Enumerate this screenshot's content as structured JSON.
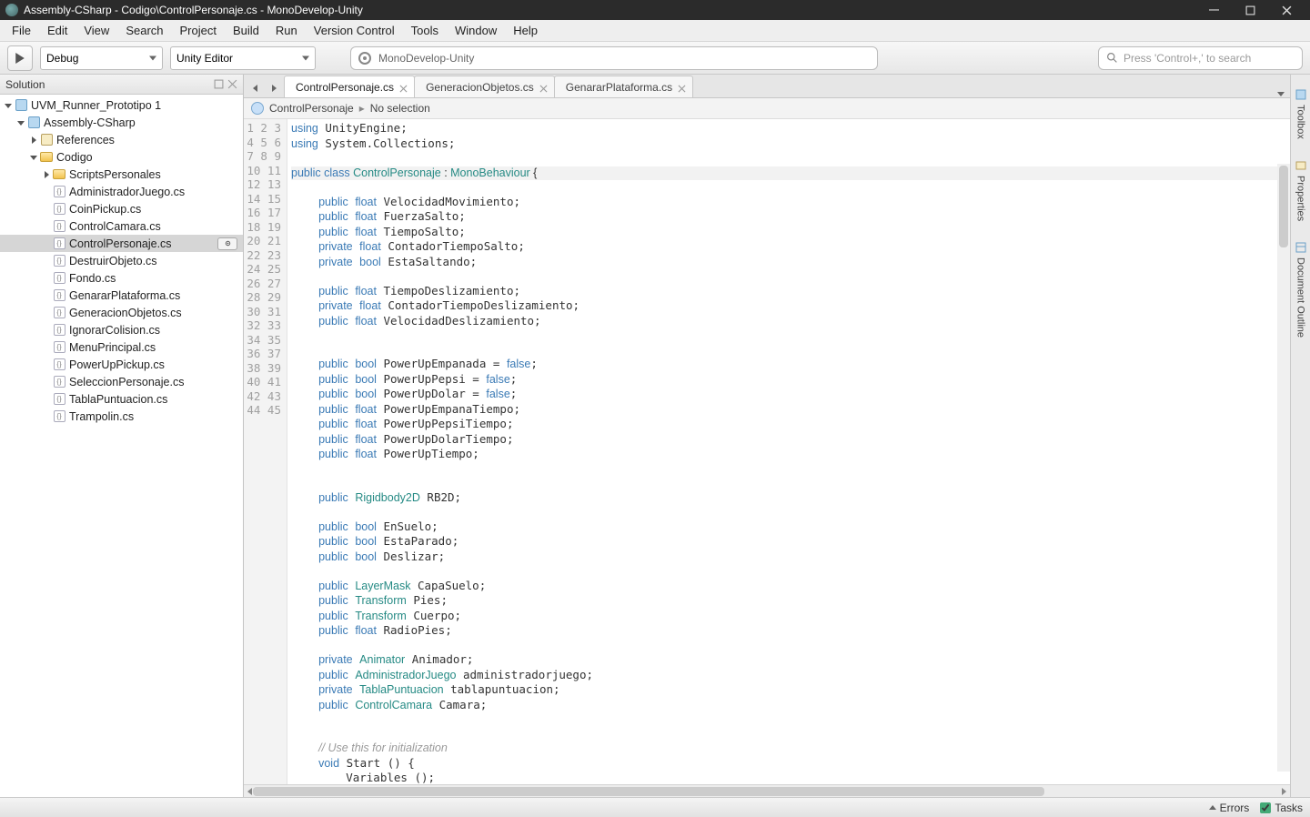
{
  "window_title": "Assembly-CSharp - Codigo\\ControlPersonaje.cs - MonoDevelop-Unity",
  "menubar": [
    "File",
    "Edit",
    "View",
    "Search",
    "Project",
    "Build",
    "Run",
    "Version Control",
    "Tools",
    "Window",
    "Help"
  ],
  "toolbar": {
    "config_selected": "Debug",
    "target_selected": "Unity Editor",
    "mid_search_label": "MonoDevelop-Unity",
    "right_search_placeholder": "Press 'Control+,' to search"
  },
  "solution": {
    "panel_title": "Solution",
    "root": "UVM_Runner_Prototipo 1",
    "assembly": "Assembly-CSharp",
    "references": "References",
    "codigo": "Codigo",
    "scripts": "ScriptsPersonales",
    "files": [
      "AdministradorJuego.cs",
      "CoinPickup.cs",
      "ControlCamara.cs",
      "ControlPersonaje.cs",
      "DestruirObjeto.cs",
      "Fondo.cs",
      "GenararPlataforma.cs",
      "GeneracionObjetos.cs",
      "IgnorarColision.cs",
      "MenuPrincipal.cs",
      "PowerUpPickup.cs",
      "SeleccionPersonaje.cs",
      "TablaPuntuacion.cs",
      "Trampolin.cs"
    ],
    "selected_file_index": 3
  },
  "tabs": [
    {
      "label": "ControlPersonaje.cs",
      "active": true
    },
    {
      "label": "GeneracionObjetos.cs",
      "active": false
    },
    {
      "label": "GenararPlataforma.cs",
      "active": false
    }
  ],
  "breadcrumb": {
    "class": "ControlPersonaje",
    "member": "No selection"
  },
  "code": {
    "first_line": 1,
    "highlight_line": 4,
    "lines": [
      [
        [
          "kw",
          "using"
        ],
        [
          "",
          " UnityEngine;"
        ]
      ],
      [
        [
          "kw",
          "using"
        ],
        [
          "",
          " System.Collections;"
        ]
      ],
      [
        [
          "",
          ""
        ]
      ],
      [
        [
          "kw",
          "public"
        ],
        [
          "",
          " "
        ],
        [
          "kw",
          "class"
        ],
        [
          "",
          " "
        ],
        [
          "type",
          "ControlPersonaje"
        ],
        [
          "",
          " : "
        ],
        [
          "type",
          "MonoBehaviour"
        ],
        [
          "",
          " {"
        ]
      ],
      [
        [
          "",
          ""
        ]
      ],
      [
        [
          "",
          "    "
        ],
        [
          "kw",
          "public"
        ],
        [
          "",
          " "
        ],
        [
          "kw",
          "float"
        ],
        [
          "",
          " VelocidadMovimiento;"
        ]
      ],
      [
        [
          "",
          "    "
        ],
        [
          "kw",
          "public"
        ],
        [
          "",
          " "
        ],
        [
          "kw",
          "float"
        ],
        [
          "",
          " FuerzaSalto;"
        ]
      ],
      [
        [
          "",
          "    "
        ],
        [
          "kw",
          "public"
        ],
        [
          "",
          " "
        ],
        [
          "kw",
          "float"
        ],
        [
          "",
          " TiempoSalto;"
        ]
      ],
      [
        [
          "",
          "    "
        ],
        [
          "kw",
          "private"
        ],
        [
          "",
          " "
        ],
        [
          "kw",
          "float"
        ],
        [
          "",
          " ContadorTiempoSalto;"
        ]
      ],
      [
        [
          "",
          "    "
        ],
        [
          "kw",
          "private"
        ],
        [
          "",
          " "
        ],
        [
          "kw",
          "bool"
        ],
        [
          "",
          " EstaSaltando;"
        ]
      ],
      [
        [
          "",
          ""
        ]
      ],
      [
        [
          "",
          "    "
        ],
        [
          "kw",
          "public"
        ],
        [
          "",
          " "
        ],
        [
          "kw",
          "float"
        ],
        [
          "",
          " TiempoDeslizamiento;"
        ]
      ],
      [
        [
          "",
          "    "
        ],
        [
          "kw",
          "private"
        ],
        [
          "",
          " "
        ],
        [
          "kw",
          "float"
        ],
        [
          "",
          " ContadorTiempoDeslizamiento;"
        ]
      ],
      [
        [
          "",
          "    "
        ],
        [
          "kw",
          "public"
        ],
        [
          "",
          " "
        ],
        [
          "kw",
          "float"
        ],
        [
          "",
          " VelocidadDeslizamiento;"
        ]
      ],
      [
        [
          "",
          ""
        ]
      ],
      [
        [
          "",
          ""
        ]
      ],
      [
        [
          "",
          "    "
        ],
        [
          "kw",
          "public"
        ],
        [
          "",
          " "
        ],
        [
          "kw",
          "bool"
        ],
        [
          "",
          " PowerUpEmpanada = "
        ],
        [
          "lit",
          "false"
        ],
        [
          "",
          ";"
        ]
      ],
      [
        [
          "",
          "    "
        ],
        [
          "kw",
          "public"
        ],
        [
          "",
          " "
        ],
        [
          "kw",
          "bool"
        ],
        [
          "",
          " PowerUpPepsi = "
        ],
        [
          "lit",
          "false"
        ],
        [
          "",
          ";"
        ]
      ],
      [
        [
          "",
          "    "
        ],
        [
          "kw",
          "public"
        ],
        [
          "",
          " "
        ],
        [
          "kw",
          "bool"
        ],
        [
          "",
          " PowerUpDolar = "
        ],
        [
          "lit",
          "false"
        ],
        [
          "",
          ";"
        ]
      ],
      [
        [
          "",
          "    "
        ],
        [
          "kw",
          "public"
        ],
        [
          "",
          " "
        ],
        [
          "kw",
          "float"
        ],
        [
          "",
          " PowerUpEmpanaTiempo;"
        ]
      ],
      [
        [
          "",
          "    "
        ],
        [
          "kw",
          "public"
        ],
        [
          "",
          " "
        ],
        [
          "kw",
          "float"
        ],
        [
          "",
          " PowerUpPepsiTiempo;"
        ]
      ],
      [
        [
          "",
          "    "
        ],
        [
          "kw",
          "public"
        ],
        [
          "",
          " "
        ],
        [
          "kw",
          "float"
        ],
        [
          "",
          " PowerUpDolarTiempo;"
        ]
      ],
      [
        [
          "",
          "    "
        ],
        [
          "kw",
          "public"
        ],
        [
          "",
          " "
        ],
        [
          "kw",
          "float"
        ],
        [
          "",
          " PowerUpTiempo;"
        ]
      ],
      [
        [
          "",
          ""
        ]
      ],
      [
        [
          "",
          ""
        ]
      ],
      [
        [
          "",
          "    "
        ],
        [
          "kw",
          "public"
        ],
        [
          "",
          " "
        ],
        [
          "type",
          "Rigidbody2D"
        ],
        [
          "",
          " RB2D;"
        ]
      ],
      [
        [
          "",
          ""
        ]
      ],
      [
        [
          "",
          "    "
        ],
        [
          "kw",
          "public"
        ],
        [
          "",
          " "
        ],
        [
          "kw",
          "bool"
        ],
        [
          "",
          " EnSuelo;"
        ]
      ],
      [
        [
          "",
          "    "
        ],
        [
          "kw",
          "public"
        ],
        [
          "",
          " "
        ],
        [
          "kw",
          "bool"
        ],
        [
          "",
          " EstaParado;"
        ]
      ],
      [
        [
          "",
          "    "
        ],
        [
          "kw",
          "public"
        ],
        [
          "",
          " "
        ],
        [
          "kw",
          "bool"
        ],
        [
          "",
          " Deslizar;"
        ]
      ],
      [
        [
          "",
          ""
        ]
      ],
      [
        [
          "",
          "    "
        ],
        [
          "kw",
          "public"
        ],
        [
          "",
          " "
        ],
        [
          "type",
          "LayerMask"
        ],
        [
          "",
          " CapaSuelo;"
        ]
      ],
      [
        [
          "",
          "    "
        ],
        [
          "kw",
          "public"
        ],
        [
          "",
          " "
        ],
        [
          "type",
          "Transform"
        ],
        [
          "",
          " Pies;"
        ]
      ],
      [
        [
          "",
          "    "
        ],
        [
          "kw",
          "public"
        ],
        [
          "",
          " "
        ],
        [
          "type",
          "Transform"
        ],
        [
          "",
          " Cuerpo;"
        ]
      ],
      [
        [
          "",
          "    "
        ],
        [
          "kw",
          "public"
        ],
        [
          "",
          " "
        ],
        [
          "kw",
          "float"
        ],
        [
          "",
          " RadioPies;"
        ]
      ],
      [
        [
          "",
          ""
        ]
      ],
      [
        [
          "",
          "    "
        ],
        [
          "kw",
          "private"
        ],
        [
          "",
          " "
        ],
        [
          "type",
          "Animator"
        ],
        [
          "",
          " Animador;"
        ]
      ],
      [
        [
          "",
          "    "
        ],
        [
          "kw",
          "public"
        ],
        [
          "",
          " "
        ],
        [
          "type",
          "AdministradorJuego"
        ],
        [
          "",
          " administradorjuego;"
        ]
      ],
      [
        [
          "",
          "    "
        ],
        [
          "kw",
          "private"
        ],
        [
          "",
          " "
        ],
        [
          "type",
          "TablaPuntuacion"
        ],
        [
          "",
          " tablapuntuacion;"
        ]
      ],
      [
        [
          "",
          "    "
        ],
        [
          "kw",
          "public"
        ],
        [
          "",
          " "
        ],
        [
          "type",
          "ControlCamara"
        ],
        [
          "",
          " Camara;"
        ]
      ],
      [
        [
          "",
          ""
        ]
      ],
      [
        [
          "",
          ""
        ]
      ],
      [
        [
          "",
          "    "
        ],
        [
          "cmt",
          "// Use this for initialization"
        ]
      ],
      [
        [
          "",
          "    "
        ],
        [
          "kw",
          "void"
        ],
        [
          "",
          " Start () {"
        ]
      ],
      [
        [
          "",
          "        Variables ();"
        ]
      ]
    ]
  },
  "right_rail": [
    "Toolbox",
    "Properties",
    "Document Outline"
  ],
  "statusbar": {
    "errors": "Errors",
    "tasks": "Tasks"
  }
}
